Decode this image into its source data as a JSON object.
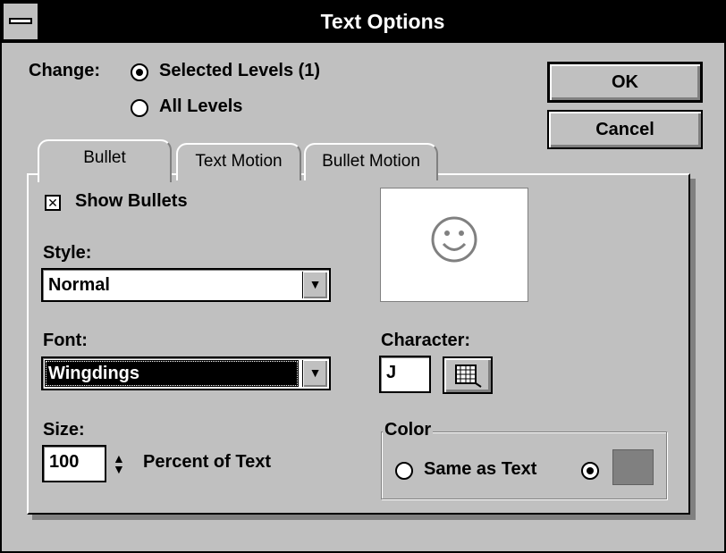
{
  "window": {
    "title": "Text Options"
  },
  "change": {
    "label": "Change:",
    "option_selected": "Selected Levels (1)",
    "option_all": "All Levels",
    "selected": "selected"
  },
  "buttons": {
    "ok": "OK",
    "cancel": "Cancel"
  },
  "tabs": [
    {
      "label": "Bullet",
      "active": true
    },
    {
      "label": "Text Motion",
      "active": false
    },
    {
      "label": "Bullet Motion",
      "active": false
    }
  ],
  "bullet": {
    "show_bullets_label": "Show Bullets",
    "show_bullets_checked": true,
    "style_label": "Style:",
    "style_value": "Normal",
    "font_label": "Font:",
    "font_value": "Wingdings",
    "size_label": "Size:",
    "size_value": "100",
    "size_unit": "Percent of Text",
    "character_label": "Character:",
    "character_value": "J",
    "color_label": "Color",
    "color_same_as_text": "Same as Text",
    "color_mode": "custom",
    "swatch_color": "#808080",
    "preview_glyph": "☺"
  }
}
